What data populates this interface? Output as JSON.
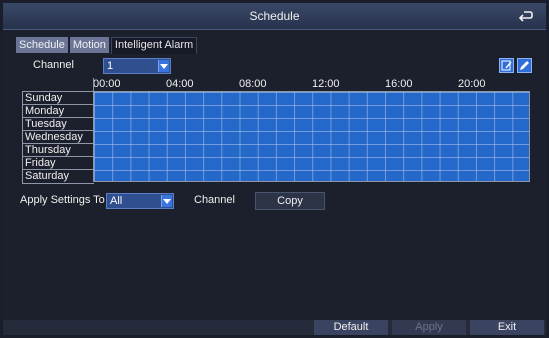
{
  "window": {
    "title": "Schedule"
  },
  "tabs": [
    {
      "label": "Schedule",
      "active": false
    },
    {
      "label": "Motion",
      "active": false
    },
    {
      "label": "Intelligent Alarm",
      "active": true
    }
  ],
  "channel": {
    "label": "Channel",
    "value": "1"
  },
  "grid": {
    "hour_labels": [
      "00:00",
      "04:00",
      "08:00",
      "12:00",
      "16:00",
      "20:00"
    ],
    "days": [
      "Sunday",
      "Monday",
      "Tuesday",
      "Wednesday",
      "Thursday",
      "Friday",
      "Saturday"
    ],
    "fill_color": "#2468c9"
  },
  "apply": {
    "label": "Apply Settings To",
    "value": "All",
    "channel_label": "Channel",
    "copy_label": "Copy"
  },
  "footer": {
    "default_label": "Default",
    "apply_label": "Apply",
    "exit_label": "Exit"
  },
  "icons": {
    "back": "return-arrow-icon",
    "channel_dropdown": "chevron-down-icon",
    "apply_dropdown": "chevron-down-icon",
    "edit": "edit-schedule-icon",
    "pencil": "pencil-icon"
  }
}
